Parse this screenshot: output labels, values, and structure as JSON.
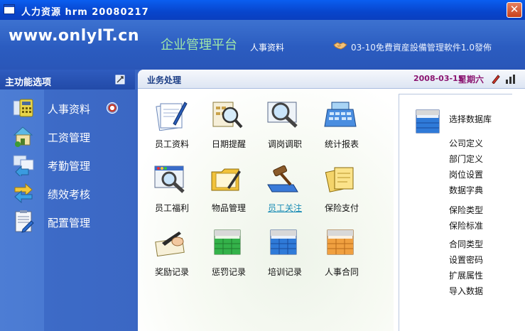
{
  "window": {
    "title": "人力资源 hrm 20080217",
    "close_glyph": "✕"
  },
  "header": {
    "site": "www.onlyIT.cn",
    "platform": "企业管理平台",
    "module": "人事资料",
    "notice": "03-10免費資産設備管理軟件1.0發佈"
  },
  "sidebar": {
    "title": "主功能选项",
    "items": [
      {
        "label": "人事资料",
        "icon": "calculator-icon"
      },
      {
        "label": "工资管理",
        "icon": "house-icon"
      },
      {
        "label": "考勤管理",
        "icon": "arrows-icon"
      },
      {
        "label": "绩效考核",
        "icon": "refresh-arrows-icon"
      },
      {
        "label": "配置管理",
        "icon": "clipboard-icon"
      }
    ]
  },
  "content": {
    "title": "业务处理",
    "date": "2008-03-15",
    "weekday": "星期六",
    "tiles": [
      {
        "label": "员工资料"
      },
      {
        "label": "日期提醒"
      },
      {
        "label": "调岗调职"
      },
      {
        "label": "统计报表"
      },
      {
        "label": "员工福利"
      },
      {
        "label": "物品管理"
      },
      {
        "label": "员工关注"
      },
      {
        "label": "保险支付"
      },
      {
        "label": "奖励记录"
      },
      {
        "label": "惩罚记录"
      },
      {
        "label": "培训记录"
      },
      {
        "label": "人事合同"
      }
    ]
  },
  "right_panel": {
    "header": "选择数据库",
    "groups": [
      [
        "公司定义",
        "部门定义",
        "岗位设置",
        "数据字典"
      ],
      [
        "保险类型",
        "保险标准"
      ],
      [
        "合同类型",
        "设置密码",
        "扩展属性",
        "导入数据"
      ]
    ]
  },
  "colors": {
    "title_bar": "#0845cc",
    "header_bg": "#2b5cc0",
    "date_text": "#8a1470",
    "link_text": "#1a8cb5"
  }
}
